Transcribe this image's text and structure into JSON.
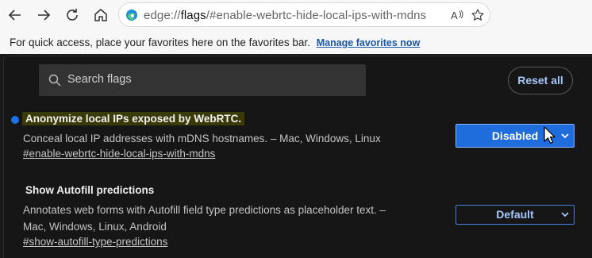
{
  "browser": {
    "url": {
      "scheme": "edge://",
      "host": "flags",
      "path": "/#enable-webrtc-hide-local-ips-with-mdns"
    },
    "favorites_bar": {
      "message": "For quick access, place your favorites here on the favorites bar.",
      "link": "Manage favorites now"
    }
  },
  "flags_page": {
    "search": {
      "placeholder": "Search flags"
    },
    "reset_label": "Reset all",
    "flags": [
      {
        "title": "Anonymize local IPs exposed by WebRTC.",
        "description": "Conceal local IP addresses with mDNS hostnames. – Mac, Windows, Linux",
        "link": "#enable-webrtc-hide-local-ips-with-mdns",
        "value": "Disabled",
        "modified": true
      },
      {
        "title": "Show Autofill predictions",
        "description": "Annotates web forms with Autofill field type predictions as placeholder text. – Mac, Windows, Linux, Android",
        "link": "#show-autofill-type-predictions",
        "value": "Default",
        "modified": false
      }
    ]
  },
  "colors": {
    "accent": "#1a73e8",
    "link_blue": "#a8c7fa",
    "highlight": "#3a3a08"
  }
}
